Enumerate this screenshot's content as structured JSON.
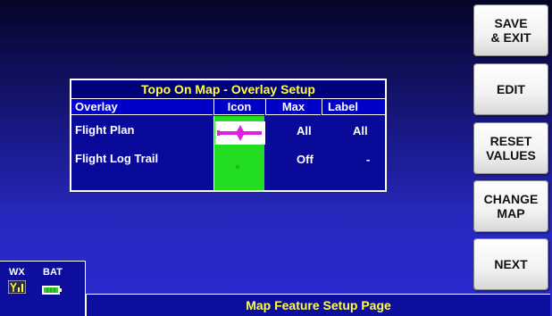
{
  "softkeys": [
    {
      "label": "SAVE\n& EXIT"
    },
    {
      "label": "EDIT"
    },
    {
      "label": "RESET\nVALUES"
    },
    {
      "label": "CHANGE\nMAP"
    },
    {
      "label": "NEXT"
    }
  ],
  "panel": {
    "title": "Topo On Map - Overlay Setup",
    "headers": {
      "overlay": "Overlay",
      "icon": "Icon",
      "max": "Max",
      "label": "Label"
    },
    "rows": [
      {
        "overlay": "Flight Plan",
        "max": "All",
        "label": "All",
        "icon": "flight-plan-line-icon"
      },
      {
        "overlay": "Flight Log Trail",
        "max": "Off",
        "label": "-",
        "icon": "trail-dot-icon"
      }
    ]
  },
  "status": {
    "wx": "WX",
    "bat": "BAT"
  },
  "bottom_bar": {
    "text": "Map Feature Setup Page"
  },
  "colors": {
    "title_text": "#ffff44",
    "icon_cell": "#22dd22",
    "flight_plan": "#e020e0",
    "softkey": "#ffffff"
  }
}
